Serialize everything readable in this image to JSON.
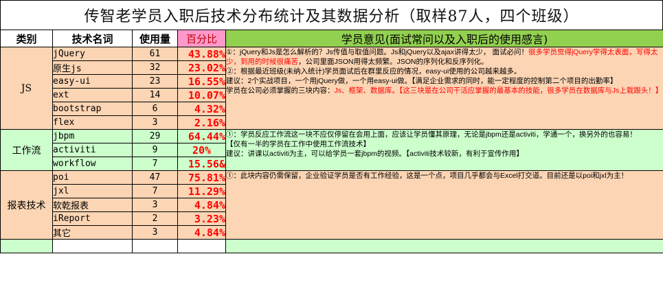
{
  "title": "传智老学员入职后技术分布统计及其数据分析（取样87人，四个班级）",
  "headers": {
    "category": "类别",
    "tech_name": "技术名词",
    "count": "使用量",
    "percent": "百分比",
    "opinion": "学员意见(面试常问以及入职后的使用感言)"
  },
  "colors": {
    "group_js": "#fcd5b4",
    "group_workflow": "#ccffcc",
    "group_report": "#fcd5b4",
    "header_percent": "#ff99cc",
    "header_opinion": "#92d050",
    "highlight": "#ff0000"
  },
  "groups": [
    {
      "category": "JS",
      "rows": [
        {
          "tech": "jQuery",
          "count": "61",
          "percent": "43.88%"
        },
        {
          "tech": "原生js",
          "count": "32",
          "percent": "23.02%"
        },
        {
          "tech": "easy-ui",
          "count": "23",
          "percent": "16.55%"
        },
        {
          "tech": "ext",
          "count": "14",
          "percent": "10.07%"
        },
        {
          "tech": "bootstrap",
          "count": "6",
          "percent": "4.32%"
        },
        {
          "tech": "flex",
          "count": "3",
          "percent": "2.16%"
        }
      ],
      "notes": [
        {
          "a": "①：jQuery和Js是怎么解析的？Js传值与取值问题。Js和jQuery以及ajax讲得太少， 面试必问！",
          "b": "很多学员觉得jQuery学得太表面，写得太少，到用的时候很痛苦",
          "c": "，公司里面JSON用得太频繁。JSON的序列化和反序列化。"
        },
        {
          "a": "②：根据最近班级(未纳入统计)学员面试后在群里反应的情况，easy-ui使用的公司越来越多。"
        },
        {
          "a": "建议：2个实战项目，一个用jQuery做，一个用easy-ui做。【满足企业需求的同时，能一定程度的控制第二个项目的出勤率】"
        },
        {
          "a": "学员在公司必须掌握的三块内容：",
          "b": "Js、框架、数据库。【这三块是在公司干活应掌握的最基本的技能，很多学员在数据库与Js上栽跟头！】"
        }
      ]
    },
    {
      "category": "工作流",
      "rows": [
        {
          "tech": "jbpm",
          "count": "29",
          "percent": "64.44%"
        },
        {
          "tech": "activiti",
          "count": "9",
          "percent": "20%"
        },
        {
          "tech": "workflow",
          "count": "7",
          "percent": "15.56&"
        }
      ],
      "notes": [
        {
          "a": "①：学员反应工作流这一块不应仅停留在会用上面，应该让学员懂其原理，无论是jbpm还是activiti，学通一个，换另外的也容易！"
        },
        {
          "a": "【仅有一半的学员在工作中使用工作流技术】"
        },
        {
          "a": "建议：讲课以activiti为主，可以给学员一套jbpm的视频。【activiti技术较新，有利于宣传作用】"
        }
      ]
    },
    {
      "category": "报表技术",
      "rows": [
        {
          "tech": "poi",
          "count": "47",
          "percent": "75.81%"
        },
        {
          "tech": "jxl",
          "count": "7",
          "percent": "11.29%"
        },
        {
          "tech": "软乾报表",
          "count": "3",
          "percent": "4.84%"
        },
        {
          "tech": "iReport",
          "count": "2",
          "percent": "3.23%"
        },
        {
          "tech": "其它",
          "count": "3",
          "percent": "4.84%"
        }
      ],
      "notes": [
        {
          "a": "①：此块内容仍需保留，企业验证学员是否有工作经验，这是一个点，项目几乎都会与Excel打交道。目前还是以poi和jxl为主！"
        }
      ]
    }
  ]
}
